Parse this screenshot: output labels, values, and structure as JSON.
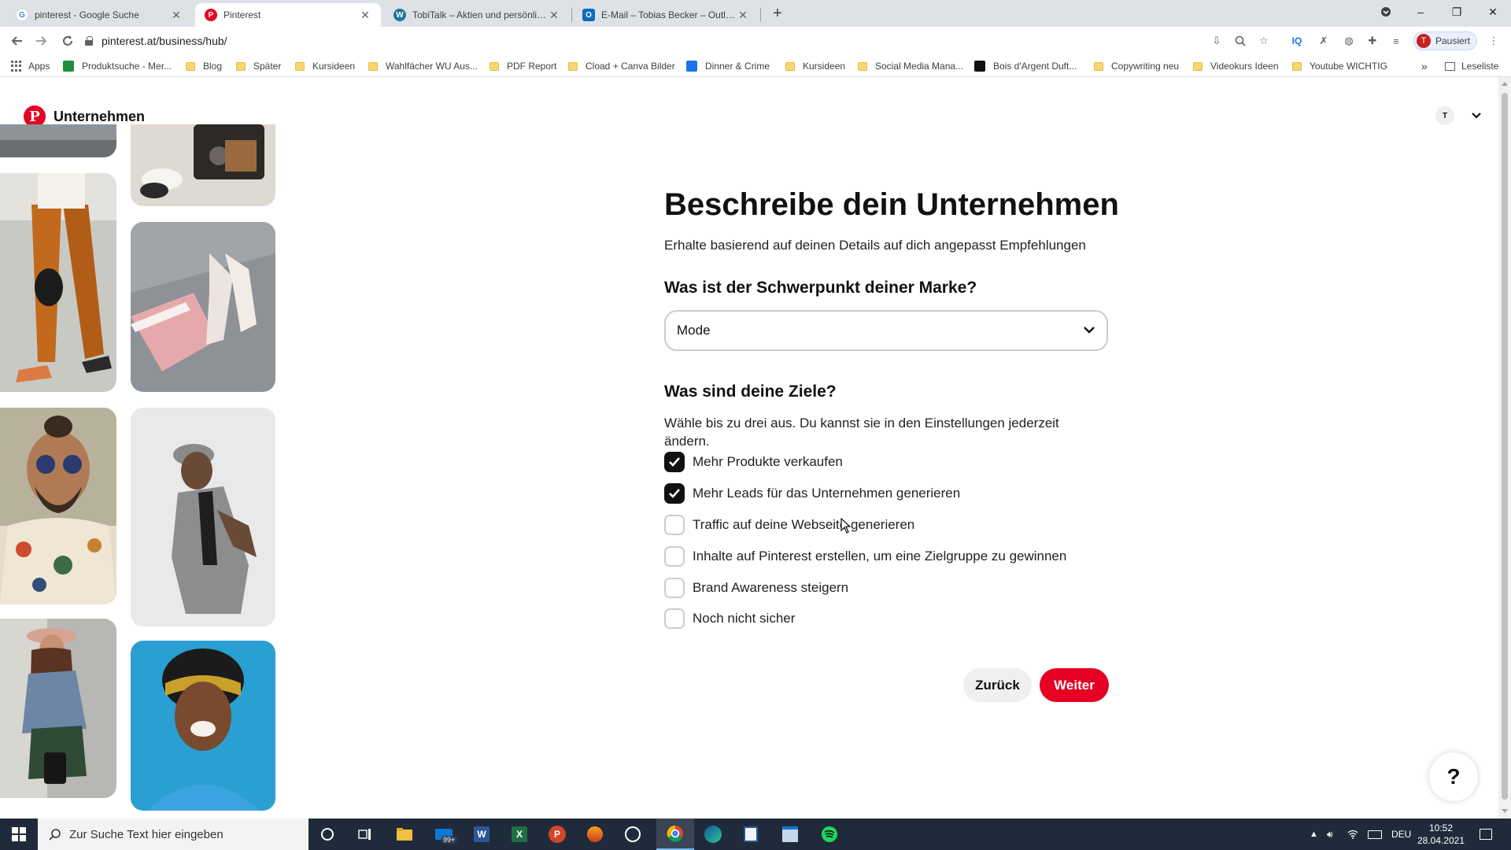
{
  "browser": {
    "tabs": [
      {
        "title": "pinterest - Google Suche",
        "favicon": "google-icon",
        "active": false
      },
      {
        "title": "Pinterest",
        "favicon": "pinterest-icon",
        "active": true
      },
      {
        "title": "TobiTalk – Aktien und persönliche",
        "favicon": "wordpress-icon",
        "active": false
      },
      {
        "title": "E-Mail – Tobias Becker – Outlook",
        "favicon": "outlook-icon",
        "active": false
      }
    ],
    "url": "pinterest.at/business/hub/",
    "profile_status": "Pausiert",
    "profile_initial": "T",
    "bookmarks": [
      {
        "label": "Apps",
        "icon": "apps-grid-icon"
      },
      {
        "label": "Produktsuche - Mer...",
        "icon": "green-square-icon"
      },
      {
        "label": "Blog",
        "icon": "folder-icon"
      },
      {
        "label": "Später",
        "icon": "folder-icon"
      },
      {
        "label": "Kursideen",
        "icon": "folder-icon"
      },
      {
        "label": "Wahlfächer WU Aus...",
        "icon": "folder-icon"
      },
      {
        "label": "PDF Report",
        "icon": "folder-icon"
      },
      {
        "label": "Cload + Canva Bilder",
        "icon": "folder-icon"
      },
      {
        "label": "Dinner & Crime",
        "icon": "blue-square-icon"
      },
      {
        "label": "Kursideen",
        "icon": "folder-icon"
      },
      {
        "label": "Social Media Mana...",
        "icon": "folder-icon"
      },
      {
        "label": "Bois d'Argent Duft...",
        "icon": "black-square-icon"
      },
      {
        "label": "Copywriting neu",
        "icon": "folder-icon"
      },
      {
        "label": "Videokurs Ideen",
        "icon": "folder-icon"
      },
      {
        "label": "Youtube WICHTIG",
        "icon": "folder-icon"
      }
    ],
    "overflow_label": "»",
    "reading_list_label": "Leseliste"
  },
  "header": {
    "brand_text": "Unternehmen",
    "avatar_initial": "T"
  },
  "form": {
    "title": "Beschreibe dein Unternehmen",
    "subtitle": "Erhalte basierend auf deinen Details auf dich angepasst Empfehlungen",
    "focus_question": "Was ist der Schwerpunkt deiner Marke?",
    "focus_value": "Mode",
    "goals_question": "Was sind deine Ziele?",
    "goals_hint": "Wähle bis zu drei aus. Du kannst sie in den Einstellungen jederzeit ändern.",
    "goals": [
      {
        "label": "Mehr Produkte verkaufen",
        "checked": true
      },
      {
        "label": "Mehr Leads für das Unternehmen generieren",
        "checked": true
      },
      {
        "label": "Traffic auf deine Webseite generieren",
        "checked": false
      },
      {
        "label": "Inhalte auf Pinterest erstellen, um eine Zielgruppe zu gewinnen",
        "checked": false
      },
      {
        "label": "Brand Awareness steigern",
        "checked": false
      },
      {
        "label": "Noch nicht sicher",
        "checked": false
      }
    ],
    "back_label": "Zurück",
    "next_label": "Weiter"
  },
  "help_label": "?",
  "colors": {
    "pinterest_red": "#e60023",
    "checkbox_checked": "#111111",
    "taskbar": "#1f2b3a"
  },
  "taskbar": {
    "search_placeholder": "Zur Suche Text hier eingeben",
    "mail_badge": "99+",
    "language": "DEU",
    "time": "10:52",
    "date": "28.04.2021"
  }
}
